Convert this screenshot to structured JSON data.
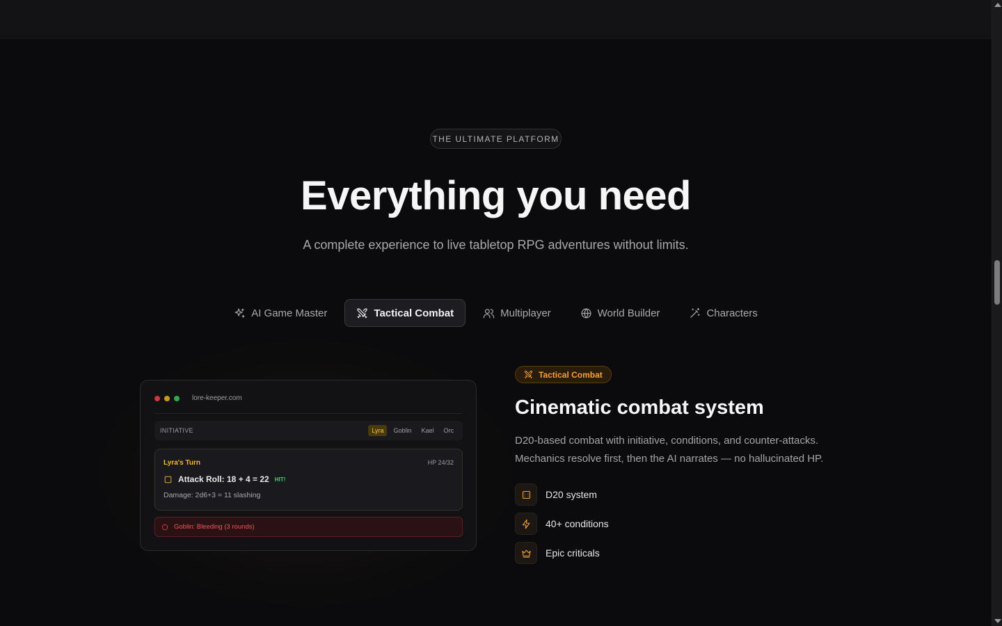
{
  "eyebrow": "THE ULTIMATE PLATFORM",
  "hero": {
    "title": "Everything you need",
    "subtitle": "A complete experience to live tabletop RPG adventures without limits."
  },
  "tabs": [
    {
      "label": "AI Game Master",
      "icon": "sparkles-icon",
      "active": false
    },
    {
      "label": "Tactical Combat",
      "icon": "crossed-swords-icon",
      "active": true
    },
    {
      "label": "Multiplayer",
      "icon": "users-icon",
      "active": false
    },
    {
      "label": "World Builder",
      "icon": "globe-icon",
      "active": false
    },
    {
      "label": "Characters",
      "icon": "magic-wand-icon",
      "active": false
    }
  ],
  "mock": {
    "url": "lore-keeper.com",
    "initiative_label": "INITIATIVE",
    "initiative": [
      "Lyra",
      "Goblin",
      "Kael",
      "Orc"
    ],
    "turn_name": "Lyra's Turn",
    "hp": "HP 24/32",
    "roll": "Attack Roll: 18 + 4 = 22",
    "hit": "HIT!",
    "damage": "Damage: 2d6+3 = 11 slashing",
    "condition": "Goblin: Bleeding (3 rounds)"
  },
  "feature": {
    "badge": "Tactical Combat",
    "title": "Cinematic combat system",
    "description": "D20-based combat with initiative, conditions, and counter-attacks. Mechanics resolve first, then the AI narrates — no hallucinated HP.",
    "items": [
      {
        "label": "D20 system",
        "icon": "dice-icon"
      },
      {
        "label": "40+ conditions",
        "icon": "lightning-icon"
      },
      {
        "label": "Epic criticals",
        "icon": "crown-icon"
      }
    ]
  },
  "colors": {
    "accent": "#f5a03a",
    "background": "#0b0b0d",
    "hit": "#3fd66b",
    "danger": "#f0484f"
  }
}
